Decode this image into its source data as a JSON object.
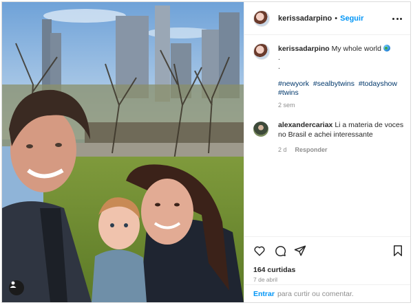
{
  "post": {
    "username": "kerissadarpino",
    "follow_label": "Seguir",
    "header_separator": "•",
    "caption_text": "My whole world",
    "caption_extra_lines": [
      ".",
      "."
    ],
    "hashtags": [
      "#newyork",
      "#sealbytwins",
      "#todayshow",
      "#twins"
    ],
    "posted_ago": "2 sem"
  },
  "comment": {
    "username": "alexandercariax",
    "text": "Li a materia de voces no Brasil e achei interessante",
    "time": "2 d",
    "reply_label": "Responder"
  },
  "actions": {
    "like_icon": "heart-icon",
    "comment_icon": "comment-icon",
    "share_icon": "share-icon",
    "save_icon": "bookmark-icon",
    "likes_text": "164 curtidas",
    "date_text": "7 de abril"
  },
  "login_bar": {
    "login_label": "Entrar",
    "suffix": "para curtir ou comentar."
  },
  "colors": {
    "accent": "#0095f6",
    "hashtag": "#00376b",
    "muted": "#8e8e8e"
  }
}
